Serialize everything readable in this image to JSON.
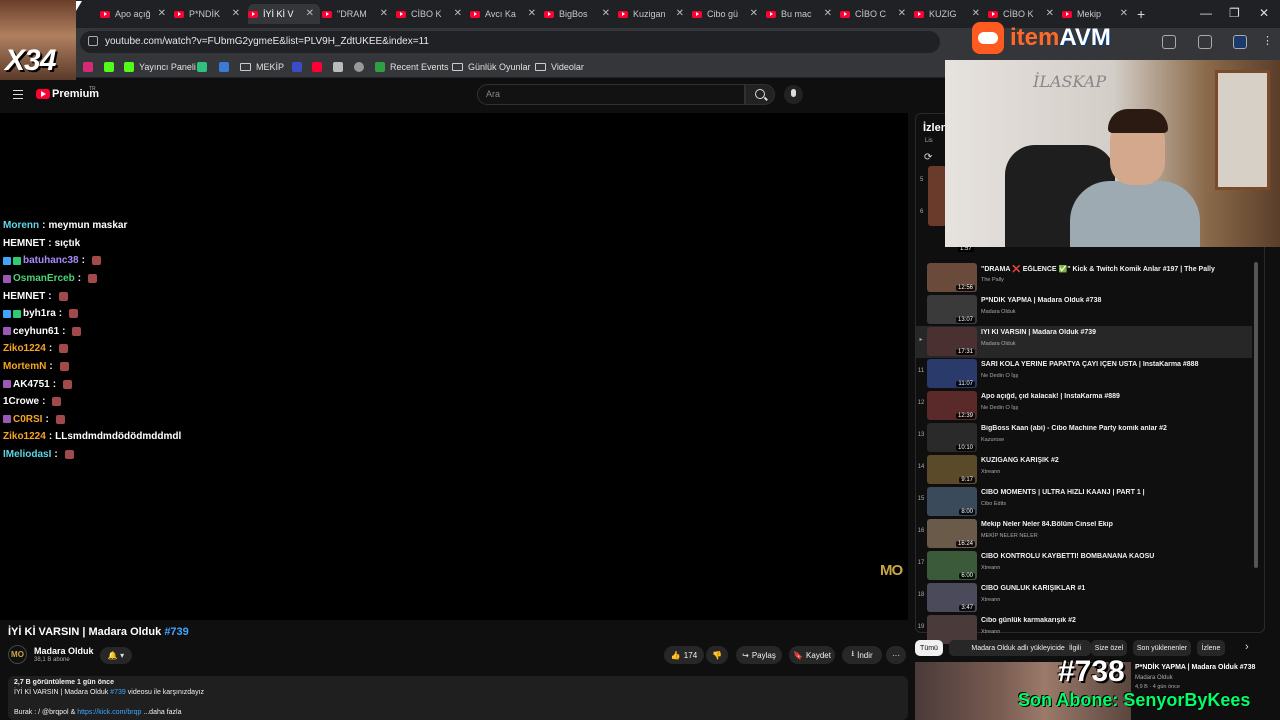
{
  "browser": {
    "tabs": [
      {
        "title": "Apo açığ"
      },
      {
        "title": "P*NDİK"
      },
      {
        "title": "İYİ Kİ V"
      },
      {
        "title": "\"DRAM"
      },
      {
        "title": "CİBO K"
      },
      {
        "title": "Avcı Ka"
      },
      {
        "title": "BigBos"
      },
      {
        "title": "Kuzigan"
      },
      {
        "title": "Cibo gü"
      },
      {
        "title": "Bu mac"
      },
      {
        "title": "CİBO C"
      },
      {
        "title": "KUZIG"
      },
      {
        "title": "CİBO K"
      },
      {
        "title": "Mekip"
      }
    ],
    "url": "youtube.com/watch?v=FUbmG2ygmeE&list=PLV9H_ZdtUKEE&index=11",
    "bookmarks": [
      {
        "label": "Yayıncı Paneli"
      },
      {
        "label": "MEKİP"
      },
      {
        "label": "Recent Events"
      },
      {
        "label": "Günlük Oyunlar"
      },
      {
        "label": "Videolar"
      }
    ]
  },
  "youtube": {
    "logo": "Premium",
    "logo_region": "TR",
    "search_placeholder": "Ara"
  },
  "chat": [
    {
      "user": "Morenn",
      "color": "#5fd6e6",
      "message": "meymun maskar"
    },
    {
      "user": "HEMNET",
      "color": "#ffffff",
      "message": "sıçtık"
    },
    {
      "user": "batuhanc38",
      "color": "#a78bfa",
      "message": ""
    },
    {
      "user": "OsmanErceb",
      "color": "#4cd37a",
      "message": ""
    },
    {
      "user": "HEMNET",
      "color": "#ffffff",
      "message": ""
    },
    {
      "user": "byh1ra",
      "color": "#ffffff",
      "message": ""
    },
    {
      "user": "ceyhun61",
      "color": "#ffffff",
      "message": ""
    },
    {
      "user": "Ziko1224",
      "color": "#f5a623",
      "message": ""
    },
    {
      "user": "MortemN",
      "color": "#f5a623",
      "message": ""
    },
    {
      "user": "AK4751",
      "color": "#ffffff",
      "message": ""
    },
    {
      "user": "1Crowe",
      "color": "#ffffff",
      "message": ""
    },
    {
      "user": "C0RSI",
      "color": "#f5a623",
      "message": ""
    },
    {
      "user": "Ziko1224",
      "color": "#f5a623",
      "message": "LLsmdmdmdödödmddmdl"
    },
    {
      "user": "IMeliodasI",
      "color": "#5fd6e6",
      "message": ""
    }
  ],
  "video": {
    "title": "İYİ Kİ VARSIN | Madara Olduk",
    "title_tag": "#739",
    "watermark": "MO",
    "channel": "Madara Olduk",
    "subscribers": "38,1 B abone",
    "likes": "174",
    "share": "Paylaş",
    "save": "Kaydet",
    "download": "İndir",
    "more": "···",
    "views_date": "2,7 B görüntüleme  1 gün önce",
    "desc_line": "İYİ Kİ VARSIN | Madara Olduk",
    "desc_tag": "#739",
    "desc_rest": "videosu ile karşınızdayız",
    "desc_credit": "Burak :",
    "desc_handle": "/ @brqpol",
    "desc_amp": "&",
    "desc_link": "https://kick.com/brqp",
    "desc_more": "...daha fazla"
  },
  "playlist": {
    "header": "İzlen",
    "sub": "Lis",
    "items": [
      {
        "index": "",
        "title": "\"DRAMA ❌ EĞLENCE ✅\" Kick & Twitch Komik Anlar #197 | The Pally",
        "channel": "The Pally",
        "duration": "12:56",
        "current": false
      },
      {
        "index": "",
        "title": "P*NDİK YAPMA | Madara Olduk #738",
        "channel": "Madara Olduk",
        "duration": "13:07",
        "current": false
      },
      {
        "index": "▸",
        "title": "İYİ Kİ VARSIN | Madara Olduk #739",
        "channel": "Madara Olduk",
        "duration": "17:31",
        "current": true
      },
      {
        "index": "11",
        "title": "SARI KOLA YERİNE PAPATYA ÇAYI İÇEN USTA | InstaKarma #888",
        "channel": "Ne Dedin O İşş",
        "duration": "11:07",
        "current": false
      },
      {
        "index": "12",
        "title": "Apo açığd, çıd kalacak! | InstaKarma #889",
        "channel": "Ne Dedin O İşş",
        "duration": "12:39",
        "current": false
      },
      {
        "index": "13",
        "title": "BigBoss Kaan (abi) - Cibo Machine Party komik anlar #2",
        "channel": "Kazurose",
        "duration": "10:10",
        "current": false
      },
      {
        "index": "14",
        "title": "KUZİGANG KARIŞIK #2",
        "channel": "Xtreann",
        "duration": "9:17",
        "current": false
      },
      {
        "index": "15",
        "title": "CİBO MOMENTS | ULTRA HIZLI KAANJ | PART 1 |",
        "channel": "Cibo Edits",
        "duration": "8:00",
        "current": false
      },
      {
        "index": "16",
        "title": "Mekip Neler Neler 84.Bölüm Cinsel Ekip",
        "channel": "MEKİP NELER NELER",
        "duration": "16:24",
        "current": false
      },
      {
        "index": "17",
        "title": "CİBO KONTROLÜ KAYBETTİ! BOMBANANA KAOSU",
        "channel": "Xtreann",
        "duration": "6:00",
        "current": false
      },
      {
        "index": "18",
        "title": "CİBO GÜNLÜK KARIŞIKLAR #1",
        "channel": "Xtreann",
        "duration": "3:47",
        "current": false
      },
      {
        "index": "19",
        "title": "Cibo günlük karmakarışık #2",
        "channel": "Xtreann",
        "duration": "",
        "current": false
      }
    ],
    "partial_times": [
      "1:57"
    ],
    "partial_nums": [
      "5",
      "6"
    ]
  },
  "chips": [
    {
      "label": "Tümü",
      "active": true
    },
    {
      "label": "Madara Olduk adlı yükleyiciden",
      "active": false
    },
    {
      "label": "İlgili",
      "active": false
    },
    {
      "label": "Size özel",
      "active": false
    },
    {
      "label": "Son yüklenenler",
      "active": false
    },
    {
      "label": "İzlene",
      "active": false
    }
  ],
  "recommendation": {
    "title": "P*NDİK YAPMA | Madara Olduk #738",
    "channel": "Madara Olduk",
    "meta": "4,9 B · 4 gün önce"
  },
  "overlays": {
    "x34": "X34",
    "brand_item": "item",
    "brand_avm": "AVM",
    "big_738": "#738",
    "son_abone": "Son Abone: SenyorByKees",
    "cam_signature": "İLASKAP"
  },
  "colors": {
    "yt_red": "#ff0033",
    "link_blue": "#3ea6ff",
    "brand_orange": "#ff6a2a",
    "abone_green": "#00ff66"
  }
}
